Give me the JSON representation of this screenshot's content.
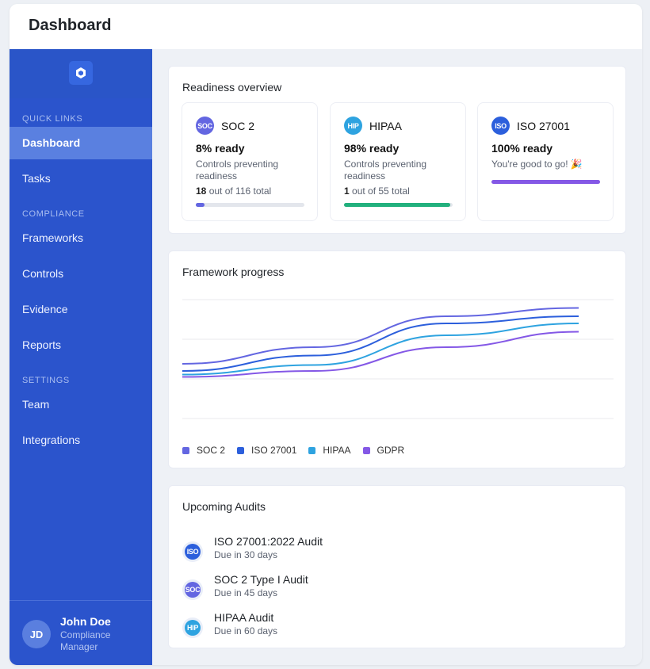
{
  "header": {
    "title": "Dashboard"
  },
  "sidebar": {
    "logo_icon": "hexagon-logo-icon",
    "sections": [
      {
        "label": "QUICK LINKS",
        "items": [
          {
            "label": "Dashboard",
            "active": true
          },
          {
            "label": "Tasks",
            "active": false
          }
        ]
      },
      {
        "label": "COMPLIANCE",
        "items": [
          {
            "label": "Frameworks",
            "active": false
          },
          {
            "label": "Controls",
            "active": false
          },
          {
            "label": "Evidence",
            "active": false
          },
          {
            "label": "Reports",
            "active": false
          }
        ]
      },
      {
        "label": "SETTINGS",
        "items": [
          {
            "label": "Team",
            "active": false
          },
          {
            "label": "Integrations",
            "active": false
          }
        ]
      }
    ],
    "user": {
      "initials": "JD",
      "name": "John Doe",
      "role": "Compliance Manager"
    }
  },
  "readiness": {
    "title": "Readiness overview",
    "cards": [
      {
        "badge": "SOC",
        "badge_color": "#6366e1",
        "name": "SOC 2",
        "ready": "8% ready",
        "subtitle": "Controls preventing readiness",
        "count_bold": "18",
        "count_rest": " out of 116 total",
        "progress": 0.08,
        "bar_color": "#6366e1"
      },
      {
        "badge": "HIP",
        "badge_color": "#2ea3e0",
        "name": "HIPAA",
        "ready": "98% ready",
        "subtitle": "Controls preventing readiness",
        "count_bold": "1",
        "count_rest": " out of 55 total",
        "progress": 0.98,
        "bar_color": "#22b07d"
      },
      {
        "badge": "ISO",
        "badge_color": "#2c5fdc",
        "name": "ISO 27001",
        "ready": "100% ready",
        "subtitle": "You're good to go! 🎉",
        "progress": 1.0,
        "bar_color": "#8458e6"
      }
    ]
  },
  "chart_data": {
    "type": "line",
    "title": "Framework progress",
    "x": [
      0,
      1,
      2,
      3
    ],
    "ylim": [
      0,
      100
    ],
    "grid": true,
    "legend_position": "bottom-left",
    "series": [
      {
        "name": "SOC 2",
        "color": "#6366e1",
        "values": [
          46,
          60,
          86,
          93
        ]
      },
      {
        "name": "ISO 27001",
        "color": "#2c5fdc",
        "values": [
          40,
          53,
          80,
          86
        ]
      },
      {
        "name": "HIPAA",
        "color": "#2ea3e0",
        "values": [
          37,
          45,
          70,
          80
        ]
      },
      {
        "name": "GDPR",
        "color": "#8458e6",
        "values": [
          35,
          40,
          60,
          73
        ]
      }
    ]
  },
  "audits": {
    "title": "Upcoming Audits",
    "items": [
      {
        "badge": "ISO",
        "badge_color": "#2c5fdc",
        "title": "ISO 27001:2022 Audit",
        "due": "Due in 30 days"
      },
      {
        "badge": "SOC",
        "badge_color": "#6366e1",
        "title": "SOC 2 Type I Audit",
        "due": "Due in 45 days"
      },
      {
        "badge": "HIP",
        "badge_color": "#2ea3e0",
        "title": "HIPAA Audit",
        "due": "Due in 60 days"
      }
    ]
  }
}
